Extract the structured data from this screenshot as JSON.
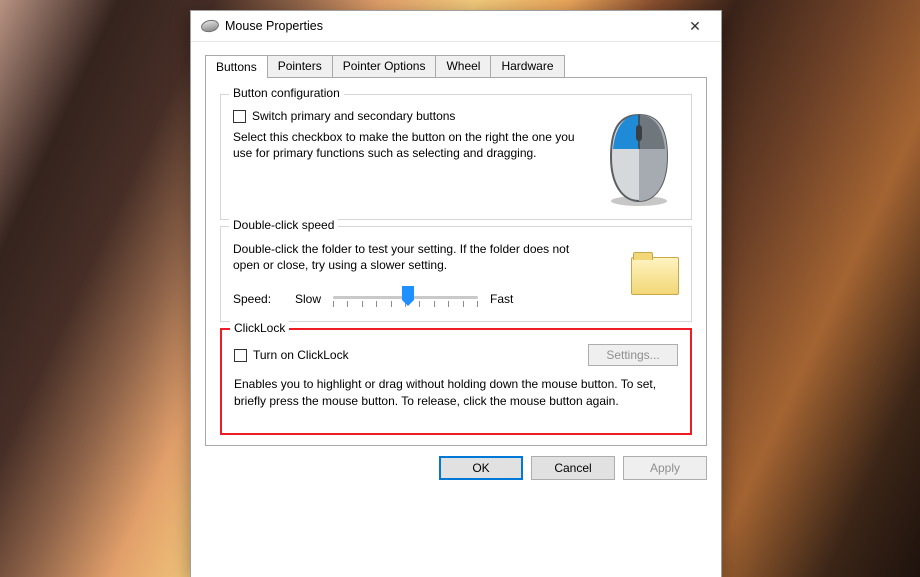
{
  "window": {
    "title": "Mouse Properties"
  },
  "tabs": [
    {
      "label": "Buttons"
    },
    {
      "label": "Pointers"
    },
    {
      "label": "Pointer Options"
    },
    {
      "label": "Wheel"
    },
    {
      "label": "Hardware"
    }
  ],
  "button_config": {
    "legend": "Button configuration",
    "checkbox_label": "Switch primary and secondary buttons",
    "description": "Select this checkbox to make the button on the right the one you use for primary functions such as selecting and dragging."
  },
  "double_click": {
    "legend": "Double-click speed",
    "description": "Double-click the folder to test your setting. If the folder does not open or close, try using a slower setting.",
    "speed_label": "Speed:",
    "slow_label": "Slow",
    "fast_label": "Fast"
  },
  "clicklock": {
    "legend": "ClickLock",
    "checkbox_label": "Turn on ClickLock",
    "settings_label": "Settings...",
    "description": "Enables you to highlight or drag without holding down the mouse button. To set, briefly press the mouse button. To release, click the mouse button again."
  },
  "actions": {
    "ok": "OK",
    "cancel": "Cancel",
    "apply": "Apply"
  }
}
